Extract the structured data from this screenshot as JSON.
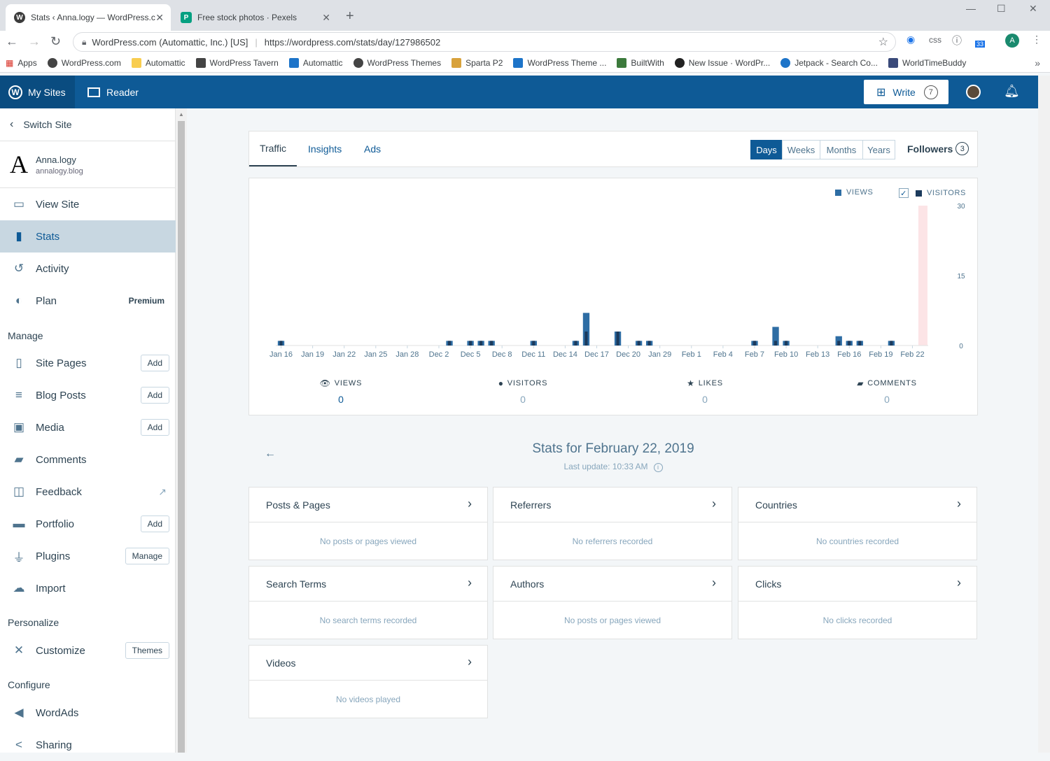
{
  "browser": {
    "tabs": [
      {
        "title": "Stats ‹ Anna.logy — WordPress.c",
        "favicon": "W"
      },
      {
        "title": "Free stock photos · Pexels",
        "favicon": "P"
      }
    ],
    "close_glyph": "✕",
    "new_tab_glyph": "+",
    "window_controls": {
      "minimize": "—",
      "maximize": "☐",
      "close": "✕"
    },
    "address": {
      "org": "WordPress.com (Automattic, Inc.) [US]",
      "separator": "|",
      "url": "https://wordpress.com/stats/day/127986502"
    },
    "extensions": {
      "css_label": "css",
      "badge": "33"
    },
    "profile_initial": "A",
    "bookmarks": [
      "Apps",
      "WordPress.com",
      "Automattic",
      "WordPress Tavern",
      "Automattic",
      "WordPress Themes",
      "Sparta P2",
      "WordPress Theme ...",
      "BuiltWith",
      "New Issue · WordPr...",
      "Jetpack - Search Co...",
      "WorldTimeBuddy"
    ],
    "bookmarks_more": "»"
  },
  "masterbar": {
    "my_sites": "My Sites",
    "reader": "Reader",
    "write": "Write",
    "drafts_count": "7"
  },
  "sidebar": {
    "switch_site": "Switch Site",
    "site_initial": "A",
    "site_name": "Anna.logy",
    "site_domain": "annalogy.blog",
    "items_top": [
      {
        "label": "View Site",
        "icon": "monitor-icon"
      },
      {
        "label": "Stats",
        "icon": "bar-chart-icon",
        "selected": true
      },
      {
        "label": "Activity",
        "icon": "history-icon"
      },
      {
        "label": "Plan",
        "icon": "plan-icon",
        "badge": "Premium"
      }
    ],
    "heading_manage": "Manage",
    "items_manage": [
      {
        "label": "Site Pages",
        "icon": "page-icon",
        "button": "Add"
      },
      {
        "label": "Blog Posts",
        "icon": "posts-icon",
        "button": "Add"
      },
      {
        "label": "Media",
        "icon": "image-icon",
        "button": "Add"
      },
      {
        "label": "Comments",
        "icon": "comments-icon"
      },
      {
        "label": "Feedback",
        "icon": "feedback-icon",
        "external": true
      },
      {
        "label": "Portfolio",
        "icon": "folder-icon",
        "button": "Add"
      },
      {
        "label": "Plugins",
        "icon": "plug-icon",
        "button": "Manage"
      },
      {
        "label": "Import",
        "icon": "cloud-upload-icon"
      }
    ],
    "heading_personalize": "Personalize",
    "items_personalize": [
      {
        "label": "Customize",
        "icon": "tools-icon",
        "button": "Themes"
      }
    ],
    "heading_configure": "Configure",
    "items_configure": [
      {
        "label": "WordAds",
        "icon": "megaphone-icon"
      },
      {
        "label": "Sharing",
        "icon": "share-icon"
      }
    ]
  },
  "stats": {
    "tabs": [
      "Traffic",
      "Insights",
      "Ads"
    ],
    "active_tab": "Traffic",
    "periods": [
      "Days",
      "Weeks",
      "Months",
      "Years"
    ],
    "active_period": "Days",
    "followers_label": "Followers",
    "followers_count": "3",
    "legend": {
      "views": "VIEWS",
      "visitors": "VISITORS",
      "visitors_checked": "✓"
    },
    "summary": [
      {
        "label": "VIEWS",
        "value": "0",
        "icon": "eye-icon"
      },
      {
        "label": "VISITORS",
        "value": "0",
        "icon": "person-icon"
      },
      {
        "label": "LIKES",
        "value": "0",
        "icon": "star-icon"
      },
      {
        "label": "COMMENTS",
        "value": "0",
        "icon": "comment-icon"
      }
    ],
    "date_title": "Stats for February 22, 2019",
    "last_update": "Last update: 10:33 AM",
    "back_glyph": "←",
    "modules": [
      {
        "title": "Posts & Pages",
        "empty": "No posts or pages viewed"
      },
      {
        "title": "Referrers",
        "empty": "No referrers recorded"
      },
      {
        "title": "Countries",
        "empty": "No countries recorded"
      },
      {
        "title": "Search Terms",
        "empty": "No search terms recorded"
      },
      {
        "title": "Authors",
        "empty": "No posts or pages viewed"
      },
      {
        "title": "Clicks",
        "empty": "No clicks recorded"
      },
      {
        "title": "Videos",
        "empty": "No videos played"
      }
    ]
  },
  "colors": {
    "views": "#2e6da4",
    "visitors": "#1b3a5c",
    "selected_day": "#fce4e6",
    "masterbar": "#0e5a96"
  },
  "chart_data": {
    "type": "bar",
    "title": "",
    "ylim": [
      0,
      30
    ],
    "y_ticks": [
      "0",
      "15",
      "30"
    ],
    "x_tick_labels": [
      "Jan 16",
      "Jan 19",
      "Jan 22",
      "Jan 25",
      "Jan 28",
      "Dec 2",
      "Dec 5",
      "Dec 8",
      "Dec 11",
      "Dec 14",
      "Dec 17",
      "Dec 20",
      "Jan 29",
      "Feb 1",
      "Feb 4",
      "Feb 7",
      "Feb 10",
      "Feb 13",
      "Feb 16",
      "Feb 19",
      "Feb 22"
    ],
    "categories": [
      "Jan 16",
      "Jan 17",
      "Jan 18",
      "Jan 19",
      "Jan 20",
      "Jan 21",
      "Jan 22",
      "Jan 23",
      "Jan 24",
      "Jan 25",
      "Jan 26",
      "Jan 27",
      "Jan 28",
      "Jan 29",
      "Jan 30",
      "Dec 1",
      "Dec 2",
      "Dec 3",
      "Dec 4",
      "Dec 5",
      "Dec 6",
      "Dec 7",
      "Dec 8",
      "Dec 9",
      "Dec 10",
      "Dec 11",
      "Dec 12",
      "Dec 13",
      "Dec 14",
      "Dec 15",
      "Dec 16",
      "Dec 17",
      "Dec 18",
      "Dec 19",
      "Dec 20",
      "Dec 21",
      "Dec 22",
      "Jan 29",
      "Jan 30",
      "Jan 31",
      "Feb 1",
      "Feb 2",
      "Feb 3",
      "Feb 4",
      "Feb 5",
      "Feb 6",
      "Feb 7",
      "Feb 8",
      "Feb 9",
      "Feb 10",
      "Feb 11",
      "Feb 12",
      "Feb 13",
      "Feb 14",
      "Feb 15",
      "Feb 16",
      "Feb 17",
      "Feb 18",
      "Feb 19",
      "Feb 20",
      "Feb 21",
      "Feb 22"
    ],
    "series": [
      {
        "name": "VIEWS",
        "values": [
          1,
          0,
          0,
          0,
          0,
          0,
          0,
          0,
          0,
          0,
          0,
          0,
          0,
          0,
          0,
          0,
          1,
          0,
          1,
          1,
          1,
          0,
          0,
          0,
          1,
          0,
          0,
          0,
          1,
          7,
          0,
          0,
          3,
          0,
          1,
          1,
          0,
          0,
          0,
          0,
          0,
          0,
          0,
          0,
          0,
          1,
          0,
          4,
          1,
          0,
          0,
          0,
          0,
          2,
          1,
          1,
          0,
          0,
          1,
          0,
          0,
          0
        ]
      },
      {
        "name": "VISITORS",
        "values": [
          1,
          0,
          0,
          0,
          0,
          0,
          0,
          0,
          0,
          0,
          0,
          0,
          0,
          0,
          0,
          0,
          1,
          0,
          1,
          1,
          1,
          0,
          0,
          0,
          1,
          0,
          0,
          0,
          1,
          3,
          0,
          0,
          3,
          0,
          1,
          1,
          0,
          0,
          0,
          0,
          0,
          0,
          0,
          0,
          0,
          1,
          0,
          1,
          1,
          0,
          0,
          0,
          0,
          1,
          1,
          1,
          0,
          0,
          1,
          0,
          0,
          0
        ]
      }
    ],
    "selected_category": "Feb 22"
  }
}
